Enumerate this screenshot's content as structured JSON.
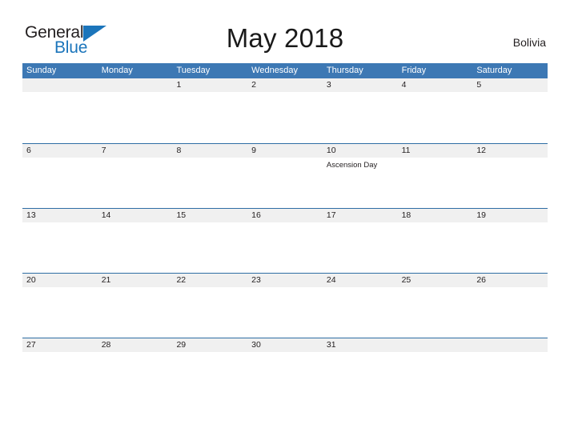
{
  "brand": {
    "name_part1": "General",
    "name_part2": "Blue",
    "accent_color": "#1b75bb"
  },
  "header": {
    "title": "May 2018",
    "country": "Bolivia"
  },
  "theme": {
    "header_bar_color": "#3d78b4",
    "row_border_color": "#2e6da4",
    "date_band_color": "#f0f0f0",
    "text_color": "#231f20"
  },
  "calendar": {
    "weekday_headers": [
      "Sunday",
      "Monday",
      "Tuesday",
      "Wednesday",
      "Thursday",
      "Friday",
      "Saturday"
    ],
    "weeks": [
      [
        {
          "day": ""
        },
        {
          "day": ""
        },
        {
          "day": "1"
        },
        {
          "day": "2"
        },
        {
          "day": "3"
        },
        {
          "day": "4"
        },
        {
          "day": "5"
        }
      ],
      [
        {
          "day": "6"
        },
        {
          "day": "7"
        },
        {
          "day": "8"
        },
        {
          "day": "9"
        },
        {
          "day": "10",
          "event": "Ascension Day"
        },
        {
          "day": "11"
        },
        {
          "day": "12"
        }
      ],
      [
        {
          "day": "13"
        },
        {
          "day": "14"
        },
        {
          "day": "15"
        },
        {
          "day": "16"
        },
        {
          "day": "17"
        },
        {
          "day": "18"
        },
        {
          "day": "19"
        }
      ],
      [
        {
          "day": "20"
        },
        {
          "day": "21"
        },
        {
          "day": "22"
        },
        {
          "day": "23"
        },
        {
          "day": "24"
        },
        {
          "day": "25"
        },
        {
          "day": "26"
        }
      ],
      [
        {
          "day": "27"
        },
        {
          "day": "28"
        },
        {
          "day": "29"
        },
        {
          "day": "30"
        },
        {
          "day": "31"
        },
        {
          "day": ""
        },
        {
          "day": ""
        }
      ]
    ]
  }
}
